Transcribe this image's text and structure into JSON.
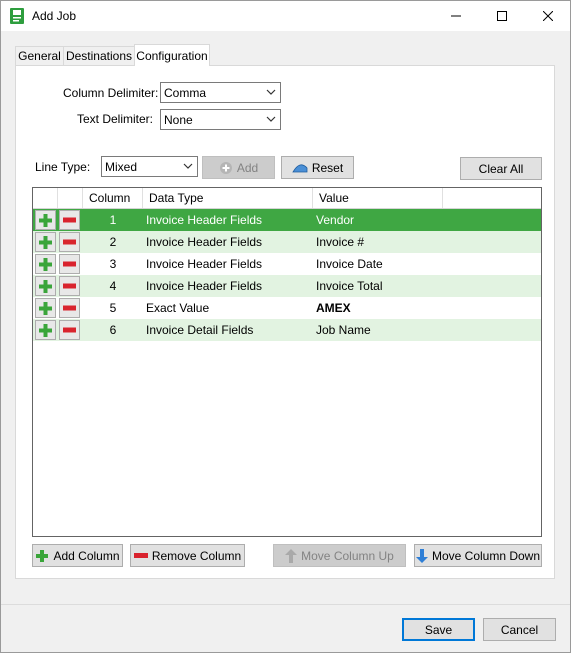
{
  "window": {
    "title": "Add Job"
  },
  "tabs": [
    {
      "label": "General"
    },
    {
      "label": "Destinations"
    },
    {
      "label": "Configuration"
    }
  ],
  "config": {
    "column_delimiter_label": "Column Delimiter:",
    "column_delimiter_value": "Comma",
    "text_delimiter_label": "Text Delimiter:",
    "text_delimiter_value": "None",
    "line_type_label": "Line Type:",
    "line_type_value": "Mixed",
    "add_label": "Add",
    "reset_label": "Reset",
    "clear_all_label": "Clear All"
  },
  "grid": {
    "headers": [
      "Column",
      "Data Type",
      "Value"
    ],
    "rows": [
      {
        "column": "1",
        "data_type": "Invoice Header Fields",
        "value": "Vendor"
      },
      {
        "column": "2",
        "data_type": "Invoice Header Fields",
        "value": "Invoice #"
      },
      {
        "column": "3",
        "data_type": "Invoice Header Fields",
        "value": "Invoice Date"
      },
      {
        "column": "4",
        "data_type": "Invoice Header Fields",
        "value": "Invoice Total"
      },
      {
        "column": "5",
        "data_type": "Exact Value",
        "value": "AMEX"
      },
      {
        "column": "6",
        "data_type": "Invoice Detail Fields",
        "value": "Job Name"
      }
    ]
  },
  "actions": {
    "add_column": "Add Column",
    "remove_column": "Remove Column",
    "move_up": "Move Column Up",
    "move_down": "Move Column Down"
  },
  "footer": {
    "save": "Save",
    "cancel": "Cancel"
  },
  "colors": {
    "selected_row": "#3fa743",
    "alt_row": "#e2f3e1",
    "accent": "#0078d7"
  }
}
